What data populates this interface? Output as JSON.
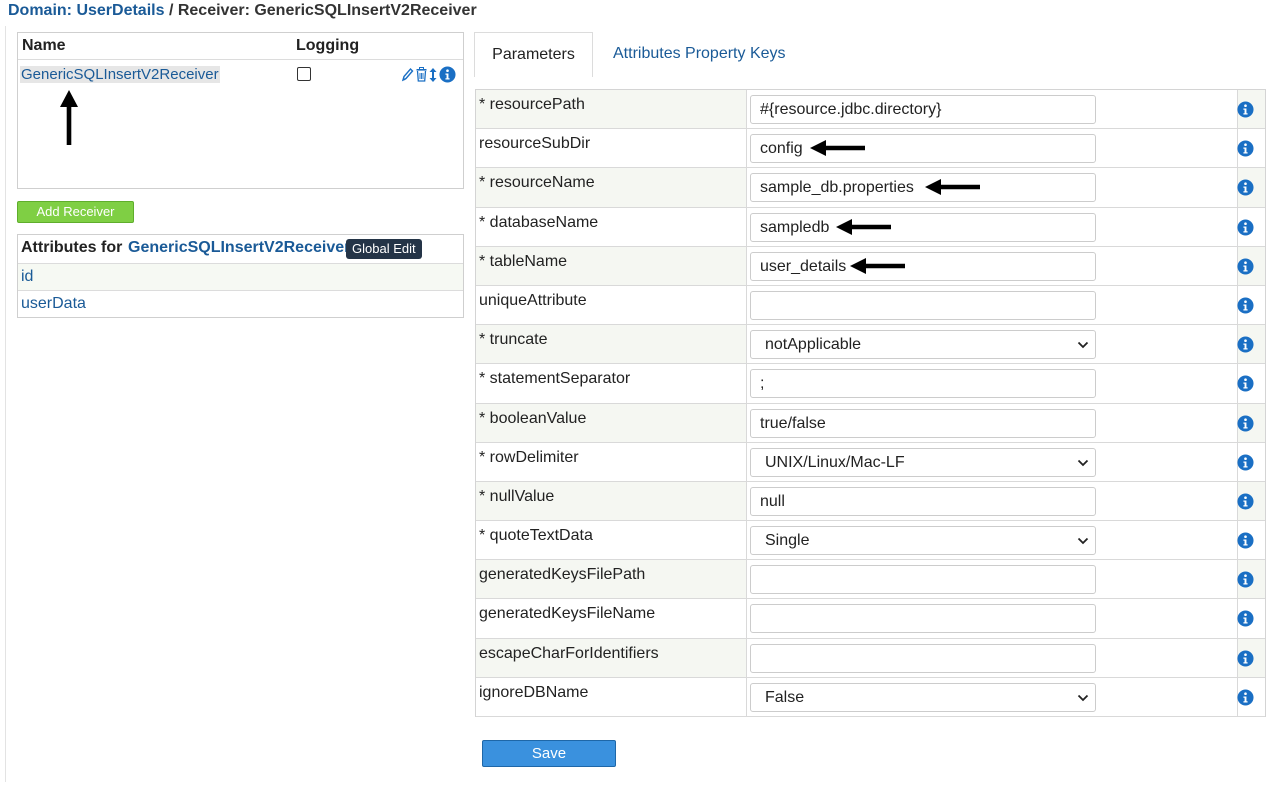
{
  "breadcrumb": {
    "domain": "Domain: UserDetails",
    "separator": " / ",
    "receiver": "Receiver: GenericSQLInsertV2Receiver"
  },
  "receivers_panel": {
    "col_name": "Name",
    "col_logging": "Logging",
    "rows": [
      {
        "name": "GenericSQLInsertV2Receiver",
        "logging_checked": false
      }
    ],
    "add_button": "Add Receiver"
  },
  "attributes_panel": {
    "title_prefix": "Attributes for",
    "receiver_name": "GenericSQLInsertV2Receiver",
    "global_edit": "Global Edit",
    "items": [
      "id",
      "userData"
    ]
  },
  "tabs": [
    {
      "label": "Parameters",
      "active": true
    },
    {
      "label": "Attributes Property Keys",
      "active": false
    }
  ],
  "parameters": [
    {
      "label": "* resourcePath",
      "value": "#{resource.jdbc.directory}",
      "type": "text",
      "marked": false
    },
    {
      "label": "resourceSubDir",
      "value": "config",
      "type": "text",
      "marked": true
    },
    {
      "label": "* resourceName",
      "value": "sample_db.properties",
      "type": "text",
      "marked": true
    },
    {
      "label": "* databaseName",
      "value": "sampledb",
      "type": "text",
      "marked": true
    },
    {
      "label": "* tableName",
      "value": "user_details",
      "type": "text",
      "marked": true
    },
    {
      "label": "uniqueAttribute",
      "value": "",
      "type": "text",
      "marked": false
    },
    {
      "label": "* truncate",
      "value": "notApplicable",
      "type": "select",
      "marked": false
    },
    {
      "label": "* statementSeparator",
      "value": ";",
      "type": "text",
      "marked": false
    },
    {
      "label": "* booleanValue",
      "value": "true/false",
      "type": "text",
      "marked": false
    },
    {
      "label": "* rowDelimiter",
      "value": "UNIX/Linux/Mac-LF",
      "type": "select",
      "marked": false
    },
    {
      "label": "* nullValue",
      "value": "null",
      "type": "text",
      "marked": false
    },
    {
      "label": "* quoteTextData",
      "value": "Single",
      "type": "select",
      "marked": false
    },
    {
      "label": "generatedKeysFilePath",
      "value": "",
      "type": "text",
      "marked": false
    },
    {
      "label": "generatedKeysFileName",
      "value": "",
      "type": "text",
      "marked": false
    },
    {
      "label": "escapeCharForIdentifiers",
      "value": "",
      "type": "text",
      "marked": false
    },
    {
      "label": "ignoreDBName",
      "value": "False",
      "type": "select",
      "marked": false
    }
  ],
  "save_button": "Save",
  "colors": {
    "link": "#1a5a97",
    "info_icon": "#1a6fc4",
    "add_button": "#7fcf44",
    "save_button": "#3a91de",
    "global_edit": "#243447"
  }
}
